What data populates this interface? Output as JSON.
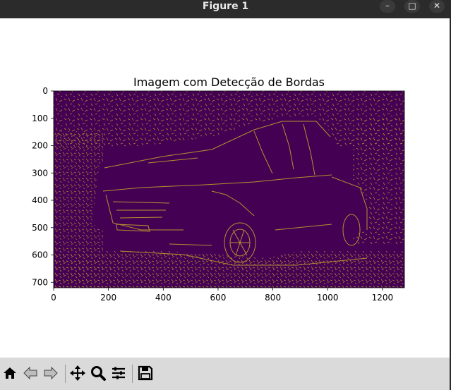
{
  "window": {
    "title": "Figure 1",
    "controls": [
      "minimize",
      "maximize",
      "close"
    ]
  },
  "chart_data": {
    "type": "heatmap",
    "title": "Imagem com Detecção de Bordas",
    "xlabel": "",
    "ylabel": "",
    "xlim": [
      0,
      1280
    ],
    "ylim": [
      720,
      0
    ],
    "x_ticks": [
      0,
      200,
      400,
      600,
      800,
      1000,
      1200
    ],
    "y_ticks": [
      0,
      100,
      200,
      300,
      400,
      500,
      600,
      700
    ],
    "colormap": "viridis (binary edge map)",
    "background_color": "#440154",
    "edge_color": "#b5912e",
    "values": "binary edge-detection image of a pickup truck (0 = no edge, 1 = edge)",
    "grid": false
  },
  "toolbar": {
    "items": [
      "home-icon",
      "back-icon",
      "forward-icon",
      "pan-icon",
      "zoom-icon",
      "configure-subplots-icon",
      "save-icon"
    ]
  }
}
